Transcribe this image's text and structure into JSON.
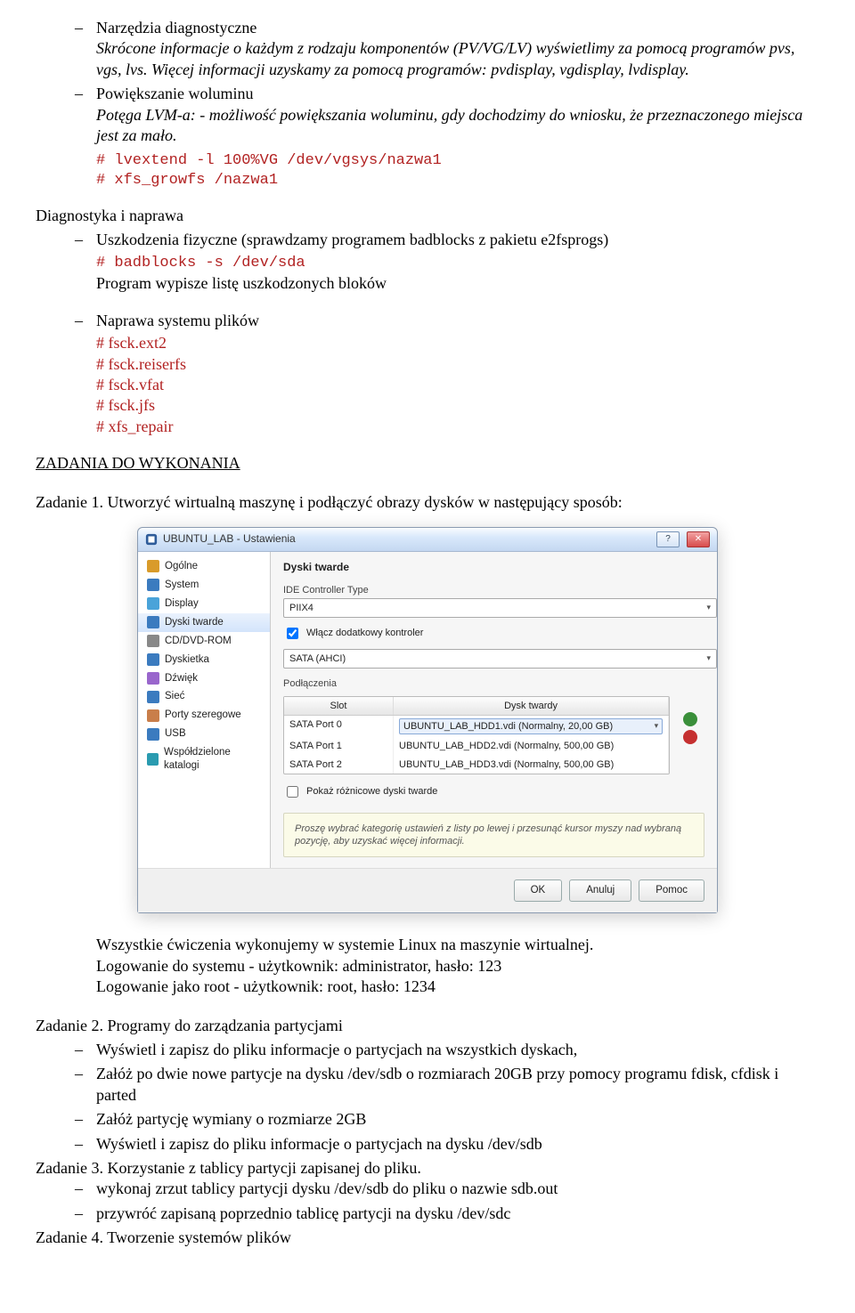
{
  "doc": {
    "b1_title": "Narzędzia diagnostyczne",
    "b1_line1": "Skrócone informacje o każdym z rodzaju komponentów (PV/VG/LV) wyświetlimy za pomocą programów pvs, vgs, lvs. Więcej informacji uzyskamy za pomocą programów: pvdisplay, vgdisplay, lvdisplay.",
    "b2_title": "Powiększanie woluminu",
    "b2_line1": "Potęga LVM-a: - możliwość powiększania woluminu, gdy dochodzimy do wniosku, że przeznaczonego miejsca jest za mało.",
    "b2_code1": "# lvextend  -l 100%VG   /dev/vgsys/nazwa1",
    "b2_code2": "# xfs_growfs /nazwa1",
    "diag_head": "Diagnostyka i naprawa",
    "d1_line": "Uszkodzenia fizyczne (sprawdzamy programem badblocks z pakietu e2fsprogs)",
    "d1_code": "# badblocks -s /dev/sda",
    "d1_out": "Program wypisze listę uszkodzonych bloków",
    "d2_line": "Naprawa systemu plików",
    "fsck": [
      "# fsck.ext2",
      "# fsck.reiserfs",
      "# fsck.vfat",
      "# fsck.jfs",
      "# xfs_repair"
    ],
    "zad_head": "ZADANIA DO WYKONANIA",
    "z1": "Zadanie 1. Utworzyć wirtualną maszynę i podłączyć obrazy dysków w następujący sposób:",
    "post1": "Wszystkie ćwiczenia wykonujemy w systemie Linux na maszynie wirtualnej.",
    "post2": "Logowanie do systemu - użytkownik: administrator, hasło: 123",
    "post3": "Logowanie jako root - użytkownik: root, hasło: 1234",
    "z2": "Zadanie 2. Programy do zarządzania partycjami",
    "z2_items": [
      "Wyświetl i zapisz do pliku informacje o partycjach na wszystkich dyskach,",
      "Załóż po dwie nowe partycje na dysku /dev/sdb o rozmiarach 20GB przy pomocy programu  fdisk, cfdisk i parted",
      "Załóż partycję wymiany o rozmiarze 2GB",
      "Wyświetl i zapisz do pliku informacje o partycjach na dysku /dev/sdb"
    ],
    "z3": "Zadanie 3. Korzystanie z tablicy partycji zapisanej do pliku.",
    "z3_items": [
      "wykonaj zrzut tablicy partycji dysku /dev/sdb do pliku o nazwie sdb.out",
      "przywróć zapisaną poprzednio tablicę partycji na dysku /dev/sdc"
    ],
    "z4": "Zadanie 4. Tworzenie systemów plików"
  },
  "vb": {
    "title": "UBUNTU_LAB - Ustawienia",
    "sidebar": [
      {
        "label": "Ogólne",
        "color": "#d99b2a"
      },
      {
        "label": "System",
        "color": "#3b7bbf"
      },
      {
        "label": "Display",
        "color": "#4aa3d9"
      },
      {
        "label": "Dyski twarde",
        "color": "#3b7bbf",
        "active": true
      },
      {
        "label": "CD/DVD-ROM",
        "color": "#888"
      },
      {
        "label": "Dyskietka",
        "color": "#3b7bbf"
      },
      {
        "label": "Dźwięk",
        "color": "#9966cc"
      },
      {
        "label": "Sieć",
        "color": "#3b7bbf"
      },
      {
        "label": "Porty szeregowe",
        "color": "#c97e4a"
      },
      {
        "label": "USB",
        "color": "#3b7bbf"
      },
      {
        "label": "Współdzielone katalogi",
        "color": "#2a9bb0"
      }
    ],
    "main_title": "Dyski twarde",
    "ide_label": "IDE Controller Type",
    "ide_value": "PIIX4",
    "extra_check": "Włącz dodatkowy kontroler",
    "sata_value": "SATA (AHCI)",
    "attach_label": "Podłączenia",
    "col_slot": "Slot",
    "col_disk": "Dysk twardy",
    "rows": [
      {
        "slot": "SATA Port 0",
        "disk": "UBUNTU_LAB_HDD1.vdi (Normalny, 20,00 GB)",
        "sel": true
      },
      {
        "slot": "SATA Port 1",
        "disk": "UBUNTU_LAB_HDD2.vdi (Normalny, 500,00 GB)"
      },
      {
        "slot": "SATA Port 2",
        "disk": "UBUNTU_LAB_HDD3.vdi (Normalny, 500,00 GB)"
      }
    ],
    "diff_check": "Pokaż różnicowe dyski twarde",
    "help": "Proszę wybrać kategorię ustawień z listy po lewej i przesunąć kursor myszy nad wybraną pozycję, aby uzyskać więcej informacji.",
    "btn_ok": "OK",
    "btn_cancel": "Anuluj",
    "btn_help": "Pomoc"
  }
}
